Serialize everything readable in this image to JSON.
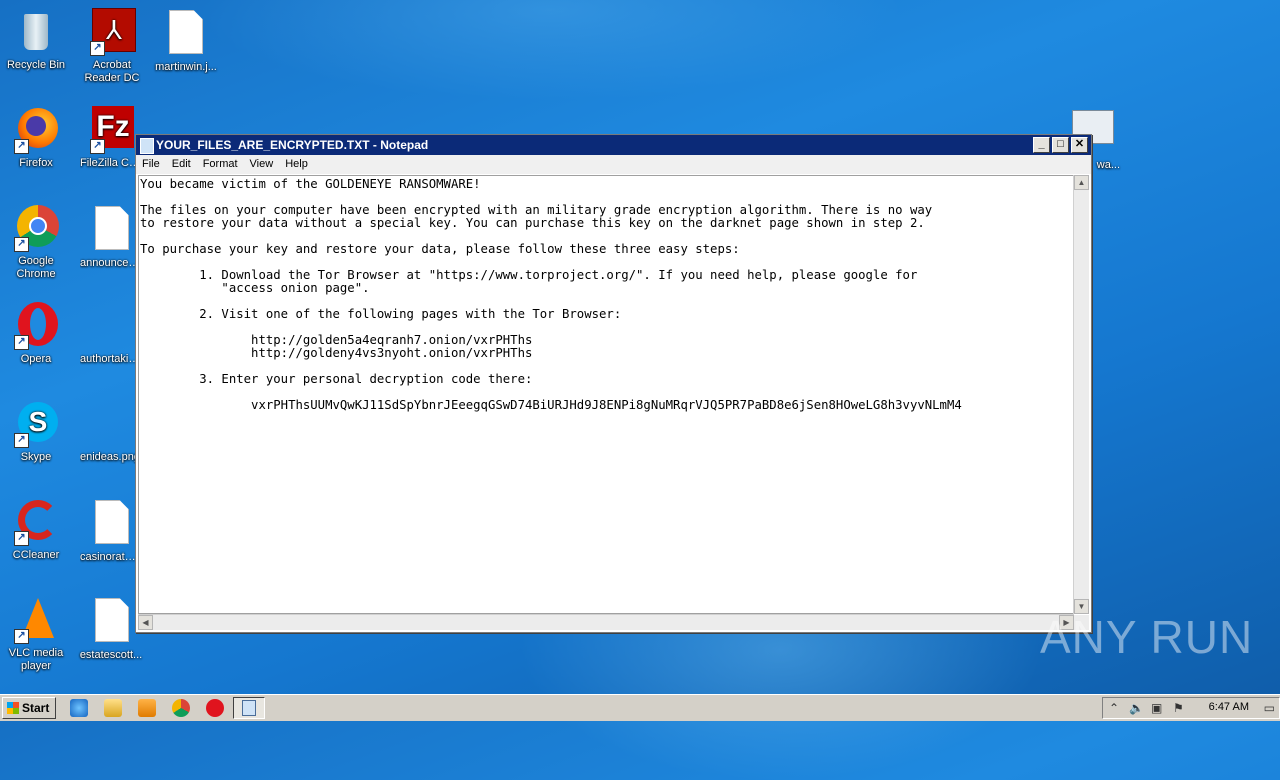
{
  "desktop": {
    "icons": [
      {
        "label": "Recycle Bin"
      },
      {
        "label": "Acrobat Reader DC"
      },
      {
        "label": "martinwin.j..."
      },
      {
        "label": "Firefox"
      },
      {
        "label": "FileZilla Client"
      },
      {
        "label": "Google Chrome"
      },
      {
        "label": "announcem..."
      },
      {
        "label": "Opera"
      },
      {
        "label": "authortakin..."
      },
      {
        "label": "Skype"
      },
      {
        "label": "enideas.png"
      },
      {
        "label": "CCleaner"
      },
      {
        "label": "casinorathe..."
      },
      {
        "label": "VLC media player"
      },
      {
        "label": "estatescott..."
      },
      {
        "label": "wa..."
      }
    ]
  },
  "notepad": {
    "title": "YOUR_FILES_ARE_ENCRYPTED.TXT - Notepad",
    "menu": [
      "File",
      "Edit",
      "Format",
      "View",
      "Help"
    ],
    "content": "You became victim of the GOLDENEYE RANSOMWARE!\n\nThe files on your computer have been encrypted with an military grade encryption algorithm. There is no way\nto restore your data without a special key. You can purchase this key on the darknet page shown in step 2.\n\nTo purchase your key and restore your data, please follow these three easy steps:\n\n        1. Download the Tor Browser at \"https://www.torproject.org/\". If you need help, please google for\n           \"access onion page\".\n\n        2. Visit one of the following pages with the Tor Browser:\n\n               http://golden5a4eqranh7.onion/vxrPHThs\n               http://goldeny4vs3nyoht.onion/vxrPHThs\n\n        3. Enter your personal decryption code there:\n\n               vxrPHThsUUMvQwKJ11SdSpYbnrJEeegqGSwD74BiURJHd9J8ENPi8gNuMRqrVJQ5PR7PaBD8e6jSen8HOweLG8h3vyvNLmM4"
  },
  "taskbar": {
    "start_label": "Start",
    "clock": "6:47 AM"
  },
  "watermark": "ANY RUN",
  "colors": {
    "desktop": "#1f8ae0",
    "titlebar": "#0b2a78",
    "taskbar": "#d4d0c8"
  }
}
